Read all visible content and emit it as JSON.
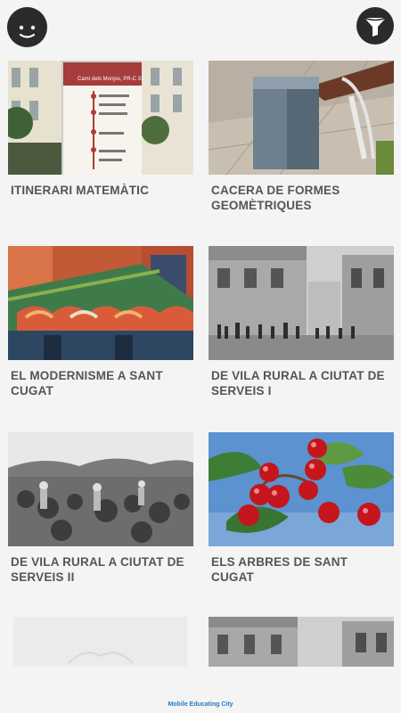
{
  "header": {
    "profile_icon": "smiley-face-icon",
    "filter_icon": "funnel-icon"
  },
  "items": [
    {
      "title": "ITINERARI MATEMÀTIC",
      "sign_text": "Camí dels Monjos, PR-C 31"
    },
    {
      "title": "CACERA DE FORMES GEOMÈTRIQUES"
    },
    {
      "title": "EL MODERNISME A SANT CUGAT"
    },
    {
      "title": "DE VILA RURAL A CIUTAT DE SERVEIS I"
    },
    {
      "title": "DE VILA RURAL A CIUTAT DE SERVEIS II"
    },
    {
      "title": "ELS ARBRES DE SANT CUGAT"
    },
    {
      "title": ""
    },
    {
      "title": ""
    }
  ],
  "footer": {
    "brand": "Mobile Educating City"
  },
  "colors": {
    "button_dark": "#2b2b2b",
    "title_grey": "#555555",
    "brand_blue": "#2a79c2"
  }
}
